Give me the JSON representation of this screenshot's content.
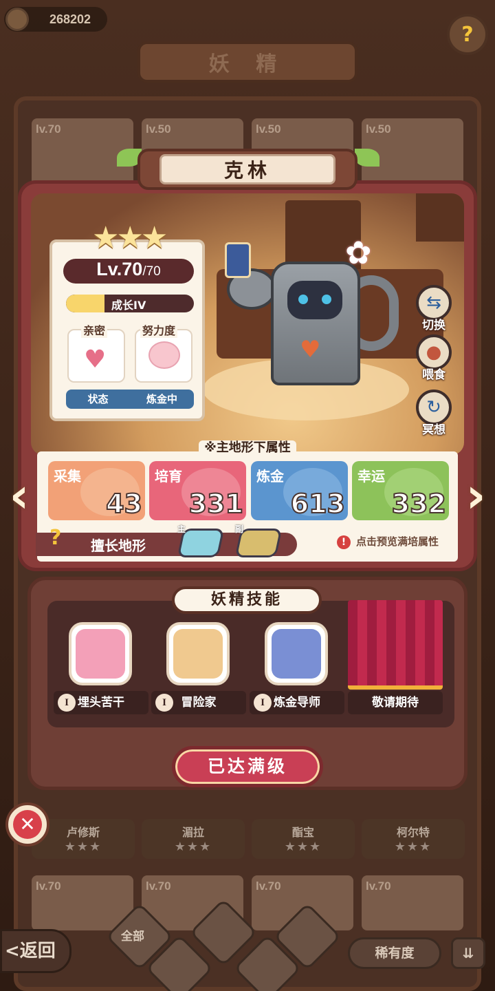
{
  "header": {
    "currency_amount": "268202",
    "title": "妖 精",
    "help_icon": "question-icon"
  },
  "background_cards": {
    "top_levels": [
      "lv.70",
      "lv.50",
      "lv.50",
      "lv.50"
    ],
    "bottom_names": [
      "卢修斯",
      "湄拉",
      "酯宝",
      "柯尔特"
    ],
    "bottom_stars": [
      "★★★",
      "★★★",
      "★★★",
      "★★★"
    ],
    "last_row_levels": [
      "lv.70",
      "lv.70",
      "lv.70",
      "lv.70"
    ]
  },
  "fairy": {
    "name": "克林",
    "stars": "★★★",
    "level": "Lv.70",
    "level_max": "/70",
    "growth_label": "成长IV",
    "growth_fraction": 0.3,
    "intimacy_label": "亲密",
    "effort_label": "努力度",
    "status_label": "状态",
    "status_value": "炼金中"
  },
  "side_actions": [
    {
      "label": "切换",
      "icon": "switch-icon"
    },
    {
      "label": "喂食",
      "icon": "feed-icon"
    },
    {
      "label": "冥想",
      "icon": "meditate-icon"
    }
  ],
  "attributes": {
    "title": "※主地形下属性",
    "items": [
      {
        "name": "采集",
        "value": "43",
        "color": "#f2a177"
      },
      {
        "name": "培育",
        "value": "331",
        "color": "#e8667a"
      },
      {
        "name": "炼金",
        "value": "613",
        "color": "#5b95cf"
      },
      {
        "name": "幸运",
        "value": "332",
        "color": "#8dc25a"
      }
    ],
    "terrain_label": "擅长地形",
    "main_tag": "主",
    "sub_tag": "副",
    "preview_label": "点击预览满培属性",
    "preview_icon": "!"
  },
  "skills": {
    "title": "妖精技能",
    "rank_symbol": "I",
    "items": [
      {
        "name": "埋头苦干",
        "icon": "angry-face-icon"
      },
      {
        "name": "冒险家",
        "icon": "treasure-bag-icon"
      },
      {
        "name": "炼金导师",
        "icon": "cauldron-icon"
      },
      {
        "name": "敬请期待",
        "icon": "curtain-icon"
      }
    ]
  },
  "max_level_button": "已达满级",
  "close_symbol": "✕",
  "bottom_bar": {
    "back_label": "<返回",
    "all_label": "全部",
    "rarity_label": "稀有度",
    "sort_symbol": "⇊"
  },
  "colors": {
    "accent_red": "#c93f55",
    "panel": "#8a3c3a",
    "star": "#fbe39a"
  }
}
